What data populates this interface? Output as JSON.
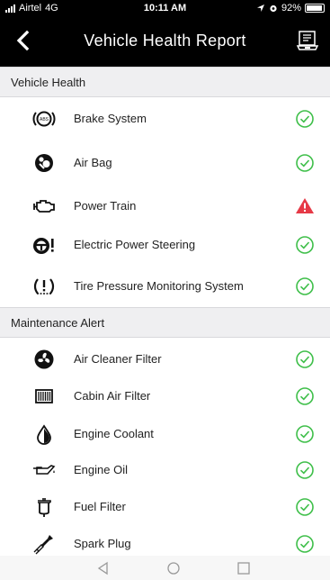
{
  "status_bar": {
    "carrier": "Airtel",
    "network": "4G",
    "time": "10:11 AM",
    "battery": "92%"
  },
  "nav": {
    "title": "Vehicle Health Report"
  },
  "colors": {
    "ok": "#3fbf4a",
    "warn": "#e63946",
    "header_bg": "#000000",
    "section_bg": "#efeff1"
  },
  "sections": {
    "vehicle_health": {
      "label": "Vehicle Health",
      "items": [
        {
          "label": "Brake System",
          "icon": "brake-icon",
          "status": "ok"
        },
        {
          "label": "Air Bag",
          "icon": "airbag-icon",
          "status": "ok"
        },
        {
          "label": "Power Train",
          "icon": "engine-icon",
          "status": "warning"
        },
        {
          "label": "Electric Power Steering",
          "icon": "steering-icon",
          "status": "ok"
        },
        {
          "label": "Tire Pressure Monitoring System",
          "icon": "tire-pressure-icon",
          "status": "ok"
        }
      ]
    },
    "maintenance_alert": {
      "label": "Maintenance Alert",
      "items": [
        {
          "label": "Air Cleaner Filter",
          "icon": "fan-icon",
          "status": "ok"
        },
        {
          "label": "Cabin Air Filter",
          "icon": "cabin-filter-icon",
          "status": "ok"
        },
        {
          "label": "Engine Coolant",
          "icon": "coolant-drop-icon",
          "status": "ok"
        },
        {
          "label": "Engine Oil",
          "icon": "oil-can-icon",
          "status": "ok"
        },
        {
          "label": "Fuel Filter",
          "icon": "fuel-filter-icon",
          "status": "ok"
        },
        {
          "label": "Spark Plug",
          "icon": "spark-plug-icon",
          "status": "ok"
        }
      ]
    }
  }
}
